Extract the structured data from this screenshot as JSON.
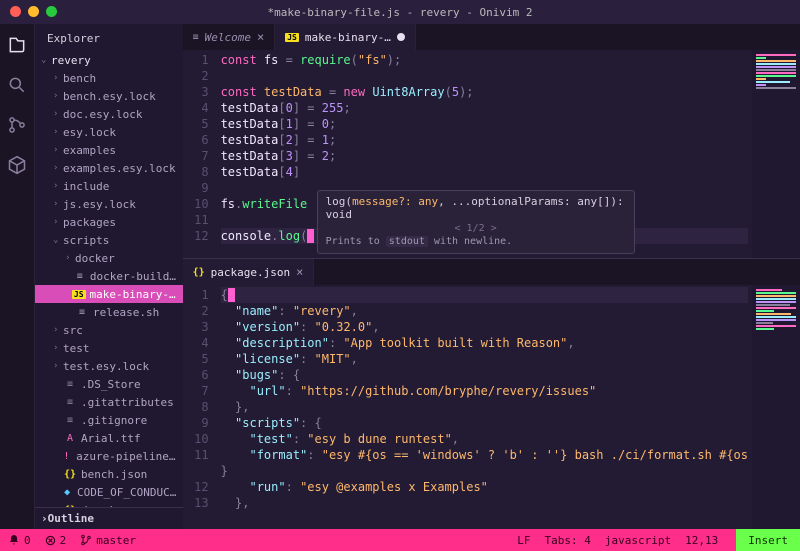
{
  "window": {
    "title": "*make-binary-file.js - revery - Onivim 2"
  },
  "sidebar": {
    "heading": "Explorer",
    "root": "revery",
    "items": [
      {
        "kind": "folder",
        "label": "bench",
        "depth": 1
      },
      {
        "kind": "folder",
        "label": "bench.esy.lock",
        "depth": 1
      },
      {
        "kind": "folder",
        "label": "doc.esy.lock",
        "depth": 1
      },
      {
        "kind": "folder",
        "label": "esy.lock",
        "depth": 1
      },
      {
        "kind": "folder",
        "label": "examples",
        "depth": 1
      },
      {
        "kind": "folder",
        "label": "examples.esy.lock",
        "depth": 1
      },
      {
        "kind": "folder",
        "label": "include",
        "depth": 1
      },
      {
        "kind": "folder",
        "label": "js.esy.lock",
        "depth": 1
      },
      {
        "kind": "folder",
        "label": "packages",
        "depth": 1
      },
      {
        "kind": "folder",
        "label": "scripts",
        "depth": 1,
        "open": true
      },
      {
        "kind": "folder",
        "label": "docker",
        "depth": 2
      },
      {
        "kind": "file",
        "label": "docker-build.sh",
        "icon": "sh",
        "depth": 2
      },
      {
        "kind": "file",
        "label": "make-binary-file.js",
        "icon": "js",
        "depth": 2,
        "active": true
      },
      {
        "kind": "file",
        "label": "release.sh",
        "icon": "sh",
        "depth": 2
      },
      {
        "kind": "folder",
        "label": "src",
        "depth": 1
      },
      {
        "kind": "folder",
        "label": "test",
        "depth": 1
      },
      {
        "kind": "folder",
        "label": "test.esy.lock",
        "depth": 1
      },
      {
        "kind": "file",
        "label": ".DS_Store",
        "icon": "file",
        "depth": 1
      },
      {
        "kind": "file",
        "label": ".gitattributes",
        "icon": "file",
        "depth": 1
      },
      {
        "kind": "file",
        "label": ".gitignore",
        "icon": "file",
        "depth": 1
      },
      {
        "kind": "file",
        "label": "Arial.ttf",
        "icon": "font",
        "depth": 1
      },
      {
        "kind": "file",
        "label": "azure-pipelines.yml",
        "icon": "yml",
        "depth": 1
      },
      {
        "kind": "file",
        "label": "bench.json",
        "icon": "json",
        "depth": 1
      },
      {
        "kind": "file",
        "label": "CODE_OF_CONDUCT.md",
        "icon": "md",
        "depth": 1
      },
      {
        "kind": "file",
        "label": "doc.json",
        "icon": "json",
        "depth": 1
      }
    ],
    "outline": "Outline"
  },
  "tabs_top": [
    {
      "icon": "menu",
      "label": "Welcome",
      "close": "×"
    },
    {
      "icon": "js",
      "label": "make-binary-…",
      "dirty": true,
      "active": true
    }
  ],
  "tabs_bottom": [
    {
      "icon": "json",
      "label": "package.json",
      "close": "×",
      "active": true
    }
  ],
  "code_top": {
    "lines": [
      {
        "n": 1,
        "html": "<span class='k-keyword'>const</span> <span class='k-white'>fs</span> <span class='k-punc'>=</span> <span class='k-func'>require</span><span class='k-punc'>(</span><span class='k-string'>\"fs\"</span><span class='k-punc'>);</span>"
      },
      {
        "n": 2,
        "html": ""
      },
      {
        "n": 3,
        "html": "<span class='k-keyword'>const</span> <span class='k-var'>testData</span> <span class='k-punc'>=</span> <span class='k-keyword'>new</span> <span class='k-type'>Uint8Array</span><span class='k-punc'>(</span><span class='k-num'>5</span><span class='k-punc'>);</span>"
      },
      {
        "n": 4,
        "html": "<span class='k-white'>testData</span><span class='k-punc'>[</span><span class='k-num'>0</span><span class='k-punc'>]</span> <span class='k-punc'>=</span> <span class='k-num'>255</span><span class='k-punc'>;</span>"
      },
      {
        "n": 5,
        "html": "<span class='k-white'>testData</span><span class='k-punc'>[</span><span class='k-num'>1</span><span class='k-punc'>]</span> <span class='k-punc'>=</span> <span class='k-num'>0</span><span class='k-punc'>;</span>"
      },
      {
        "n": 6,
        "html": "<span class='k-white'>testData</span><span class='k-punc'>[</span><span class='k-num'>2</span><span class='k-punc'>]</span> <span class='k-punc'>=</span> <span class='k-num'>1</span><span class='k-punc'>;</span>"
      },
      {
        "n": 7,
        "html": "<span class='k-white'>testData</span><span class='k-punc'>[</span><span class='k-num'>3</span><span class='k-punc'>]</span> <span class='k-punc'>=</span> <span class='k-num'>2</span><span class='k-punc'>;</span>"
      },
      {
        "n": 8,
        "html": "<span class='k-white'>testData</span><span class='k-punc'>[</span><span class='k-num'>4</span><span class='k-punc'>]</span>"
      },
      {
        "n": 9,
        "html": ""
      },
      {
        "n": 10,
        "html": "<span class='k-white'>fs</span><span class='k-punc'>.</span><span class='k-func'>writeFile</span>"
      },
      {
        "n": 11,
        "html": ""
      },
      {
        "n": 12,
        "hl": true,
        "html": "<span class='k-white'>console</span><span class='k-punc'>.</span><span class='k-func'>log</span><span class='k-punc'>(</span><span class='cursor-block'></span>"
      }
    ]
  },
  "code_bottom": {
    "lines": [
      {
        "n": 1,
        "hl": true,
        "html": "<span class='k-punc'>{</span><span class='cursor-block'></span>"
      },
      {
        "n": 2,
        "html": "  <span class='k-prop'>\"name\"</span><span class='k-punc'>:</span> <span class='k-string'>\"revery\"</span><span class='k-punc'>,</span>"
      },
      {
        "n": 3,
        "html": "  <span class='k-prop'>\"version\"</span><span class='k-punc'>:</span> <span class='k-string'>\"0.32.0\"</span><span class='k-punc'>,</span>"
      },
      {
        "n": 4,
        "html": "  <span class='k-prop'>\"description\"</span><span class='k-punc'>:</span> <span class='k-string'>\"App toolkit built with Reason\"</span><span class='k-punc'>,</span>"
      },
      {
        "n": 5,
        "html": "  <span class='k-prop'>\"license\"</span><span class='k-punc'>:</span> <span class='k-string'>\"MIT\"</span><span class='k-punc'>,</span>"
      },
      {
        "n": 6,
        "html": "  <span class='k-prop'>\"bugs\"</span><span class='k-punc'>:</span> <span class='k-punc'>{</span>"
      },
      {
        "n": 7,
        "html": "    <span class='k-prop'>\"url\"</span><span class='k-punc'>:</span> <span class='k-string'>\"https://github.com/bryphe/revery/issues\"</span>"
      },
      {
        "n": 8,
        "html": "  <span class='k-punc'>},</span>"
      },
      {
        "n": 9,
        "html": "  <span class='k-prop'>\"scripts\"</span><span class='k-punc'>:</span> <span class='k-punc'>{</span>"
      },
      {
        "n": 10,
        "html": "    <span class='k-prop'>\"test\"</span><span class='k-punc'>:</span> <span class='k-string'>\"esy b dune runtest\"</span><span class='k-punc'>,</span>"
      },
      {
        "n": 11,
        "html": "    <span class='k-prop'>\"format\"</span><span class='k-punc'>:</span> <span class='k-string'>\"esy #{os == 'windows' ? 'b' : ''} bash ./ci/format.sh #{os</span>"
      },
      {
        "n": "",
        "html": "<span class='k-punc'>}</span>"
      },
      {
        "n": 12,
        "html": "    <span class='k-prop'>\"run\"</span><span class='k-punc'>:</span> <span class='k-string'>\"esy @examples x Examples\"</span>"
      },
      {
        "n": 13,
        "html": "  <span class='k-punc'>},</span>"
      }
    ]
  },
  "signature": {
    "sig_pre": "log(",
    "sig_param": "message?: any",
    "sig_rest": ", ...optionalParams: any[]): void",
    "pager": "< 1/2 >",
    "doc_pre": "Prints to ",
    "doc_code": "stdout",
    "doc_post": " with newline."
  },
  "status": {
    "problems": "0",
    "errors": "2",
    "branch": "master",
    "eol": "LF",
    "tabs": "Tabs: 4",
    "lang": "javascript",
    "pos": "12,13",
    "mode": "Insert"
  }
}
